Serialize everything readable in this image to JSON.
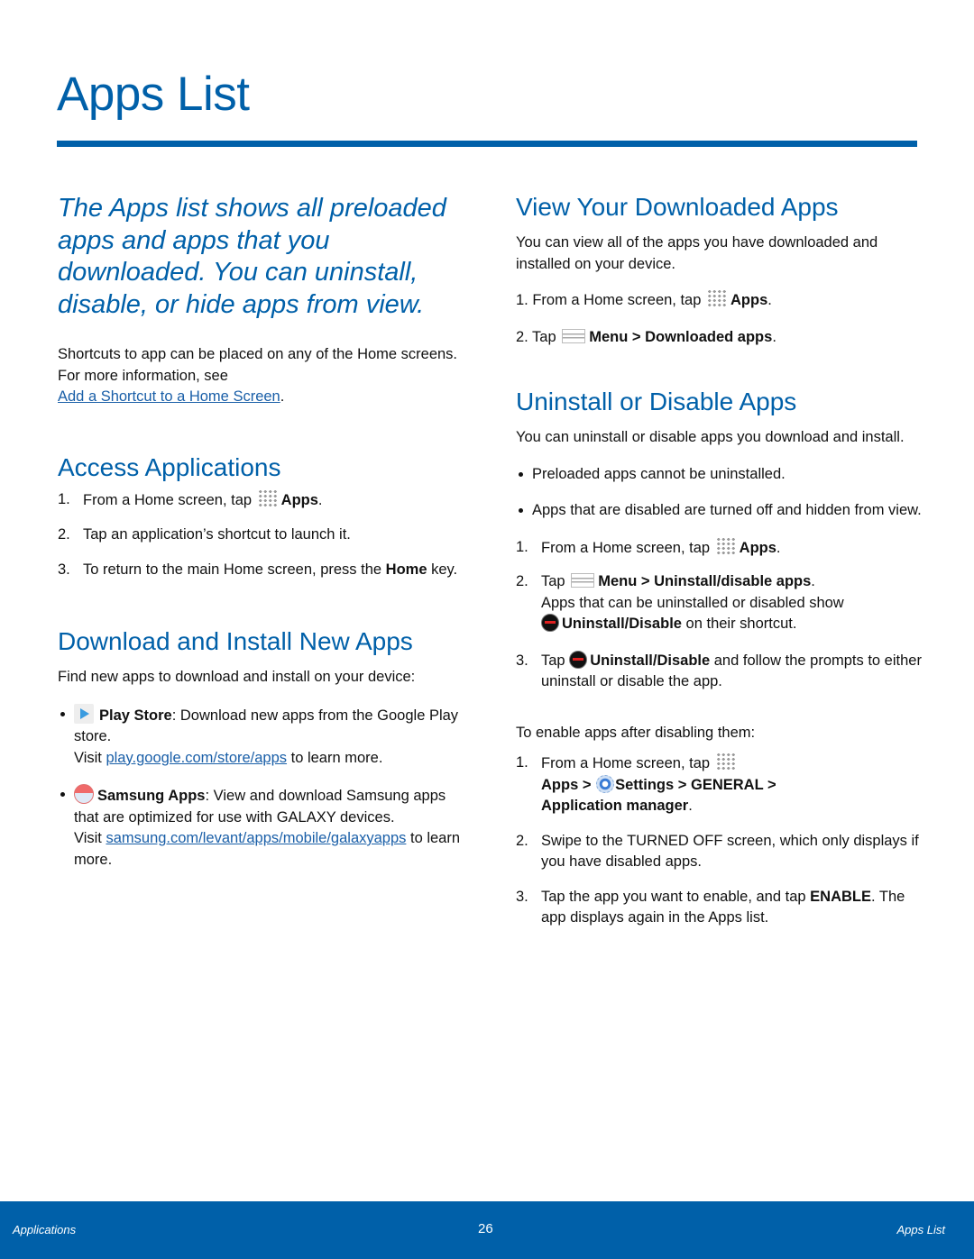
{
  "page": {
    "title": "Apps List",
    "accent_color": "#0060a9"
  },
  "left": {
    "intro": "The Apps list shows all preloaded apps and apps that you downloaded. You can uninstall, disable, or hide apps from view.",
    "shortcut_text": "Shortcuts to app can be placed on any of the Home screens. For more information, see",
    "shortcut_link": "Add a Shortcut to a Home Screen",
    "access": {
      "heading": "Access Applications",
      "steps": [
        {
          "num": "1.",
          "pre": "From a Home screen, tap",
          "icon": "apps-grid-icon",
          "bold": "Apps",
          "post": "."
        },
        {
          "num": "2.",
          "text": "Tap an application’s shortcut to launch it."
        },
        {
          "num": "3.",
          "pre": "To return to the main Home screen, press the",
          "bold": "Home",
          "post": "key."
        }
      ]
    },
    "download": {
      "heading": "Download and Install New Apps",
      "intro": "Find new apps to download and install on your device:",
      "items": [
        {
          "icon": "play-store-icon",
          "bold": "Play Store",
          "text": ": Download new apps from the Google Play store.",
          "visit": "Visit",
          "link": "play.google.com/store/apps",
          "after": "to learn more."
        },
        {
          "icon": "samsung-apps-icon",
          "bold": "Samsung Apps",
          "text": ": View and download Samsung apps that are optimized for use with GALAXY devices.",
          "visit": "Visit",
          "link": "samsung.com/levant/apps/mobile/galaxyapps",
          "after": "to learn more."
        }
      ]
    }
  },
  "right": {
    "downloaded": {
      "heading": "View Your Downloaded Apps",
      "intro": "You can view all of the apps you have downloaded and installed on your device.",
      "step1_pre": "1. From a Home screen, tap",
      "step1_bold": "Apps",
      "step2_pre": "2. Tap",
      "step2_bold": "Menu > Downloaded apps"
    },
    "uninstall": {
      "heading": "Uninstall or Disable Apps",
      "intro": "You can uninstall or disable apps you download and install.",
      "bullets": [
        "Preloaded apps cannot be uninstalled.",
        "Apps that are disabled are turned off and hidden from view."
      ],
      "step1_pre": "From a Home screen, tap",
      "step1_bold": "Apps",
      "step2_pre": "Tap",
      "step2_bold": "Menu > Uninstall/disable apps",
      "step2_line2": "Apps that can be uninstalled or disabled show",
      "step2_bold2": "Uninstall/Disable",
      "step2_post2": "on their shortcut.",
      "step3_pre": "Tap",
      "step3_bold": "Uninstall/Disable",
      "step3_post": "and follow the prompts to either uninstall  or disable the app.",
      "enable_intro": "To enable apps after disabling them:",
      "e1_pre": "From a Home screen, tap",
      "e1_apps": "Apps >",
      "e1_settings": "Settings",
      "e1_rest": " > GENERAL >",
      "e1_manager": "Application manager",
      "e2": "Swipe to the TURNED OFF screen, which only displays if you have disabled apps.",
      "e3_pre": "Tap the app you want to enable, and tap",
      "e3_bold": "ENABLE",
      "e3_post": ". The app displays again in the Apps list."
    }
  },
  "footer": {
    "left": "Applications",
    "page_number": "26",
    "right": "Apps List"
  }
}
